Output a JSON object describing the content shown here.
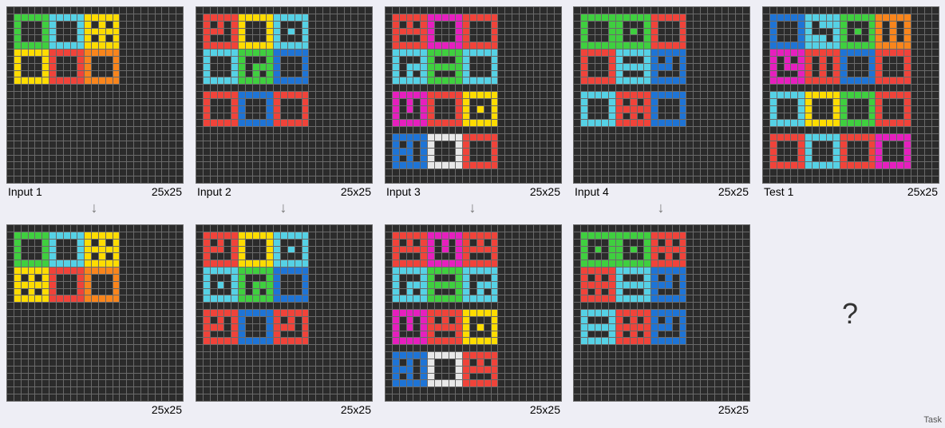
{
  "colors": {
    "0": "#2b2b2b",
    "1": "#1e74d6",
    "2": "#f0433a",
    "3": "#3fcf3f",
    "4": "#ffdc00",
    "5": "#999999",
    "6": "#e61fbe",
    "7": "#f9851c",
    "8": "#55d1e5",
    "9": "#6e1420",
    "W": "#e8e8e8"
  },
  "panels": [
    {
      "id": "input-1",
      "label": "Input 1",
      "size": "25x25",
      "shapes": [
        {
          "r": 1,
          "c": 1,
          "color": "3",
          "type": "box"
        },
        {
          "r": 1,
          "c": 6,
          "color": "8",
          "type": "box"
        },
        {
          "r": 1,
          "c": 11,
          "color": "4",
          "type": "dots"
        },
        {
          "r": 6,
          "c": 1,
          "color": "4",
          "type": "box"
        },
        {
          "r": 6,
          "c": 6,
          "color": "2",
          "type": "box"
        },
        {
          "r": 6,
          "c": 11,
          "color": "7",
          "type": "box"
        }
      ]
    },
    {
      "id": "input-2",
      "label": "Input 2",
      "size": "25x25",
      "shapes": [
        {
          "r": 1,
          "c": 1,
          "color": "2",
          "type": "smile"
        },
        {
          "r": 1,
          "c": 6,
          "color": "4",
          "type": "box"
        },
        {
          "r": 1,
          "c": 11,
          "color": "8",
          "type": "dot"
        },
        {
          "r": 6,
          "c": 1,
          "color": "8",
          "type": "box"
        },
        {
          "r": 6,
          "c": 6,
          "color": "3",
          "type": "hook"
        },
        {
          "r": 6,
          "c": 11,
          "color": "1",
          "type": "box"
        },
        {
          "r": 12,
          "c": 1,
          "color": "2",
          "type": "box"
        },
        {
          "r": 12,
          "c": 6,
          "color": "1",
          "type": "box"
        },
        {
          "r": 12,
          "c": 11,
          "color": "2",
          "type": "box"
        }
      ]
    },
    {
      "id": "input-3",
      "label": "Input 3",
      "size": "25x25",
      "shapes": [
        {
          "r": 1,
          "c": 1,
          "color": "2",
          "type": "face"
        },
        {
          "r": 1,
          "c": 6,
          "color": "6",
          "type": "box"
        },
        {
          "r": 1,
          "c": 11,
          "color": "2",
          "type": "box"
        },
        {
          "r": 6,
          "c": 1,
          "color": "8",
          "type": "hook"
        },
        {
          "r": 6,
          "c": 6,
          "color": "3",
          "type": "bar"
        },
        {
          "r": 6,
          "c": 11,
          "color": "8",
          "type": "box"
        },
        {
          "r": 12,
          "c": 1,
          "color": "6",
          "type": "cup"
        },
        {
          "r": 12,
          "c": 6,
          "color": "2",
          "type": "box"
        },
        {
          "r": 12,
          "c": 11,
          "color": "4",
          "type": "dot"
        },
        {
          "r": 18,
          "c": 1,
          "color": "1",
          "type": "vcup"
        },
        {
          "r": 18,
          "c": 6,
          "color": "W",
          "type": "box"
        },
        {
          "r": 18,
          "c": 11,
          "color": "2",
          "type": "box"
        }
      ]
    },
    {
      "id": "input-4",
      "label": "Input 4",
      "size": "25x25",
      "shapes": [
        {
          "r": 1,
          "c": 1,
          "color": "3",
          "type": "box"
        },
        {
          "r": 1,
          "c": 6,
          "color": "3",
          "type": "dot"
        },
        {
          "r": 1,
          "c": 11,
          "color": "2",
          "type": "box"
        },
        {
          "r": 6,
          "c": 1,
          "color": "2",
          "type": "box"
        },
        {
          "r": 6,
          "c": 6,
          "color": "8",
          "type": "bar"
        },
        {
          "r": 6,
          "c": 11,
          "color": "1",
          "type": "smile"
        },
        {
          "r": 12,
          "c": 1,
          "color": "8",
          "type": "box"
        },
        {
          "r": 12,
          "c": 6,
          "color": "2",
          "type": "dots"
        },
        {
          "r": 12,
          "c": 11,
          "color": "1",
          "type": "box"
        }
      ]
    },
    {
      "id": "test-1",
      "label": "Test 1",
      "size": "25x25",
      "shapes": [
        {
          "r": 1,
          "c": 1,
          "color": "1",
          "type": "box"
        },
        {
          "r": 1,
          "c": 6,
          "color": "8",
          "type": "hook2"
        },
        {
          "r": 1,
          "c": 11,
          "color": "3",
          "type": "dot"
        },
        {
          "r": 1,
          "c": 16,
          "color": "7",
          "type": "bars"
        },
        {
          "r": 6,
          "c": 1,
          "color": "6",
          "type": "hook3"
        },
        {
          "r": 6,
          "c": 6,
          "color": "2",
          "type": "bars"
        },
        {
          "r": 6,
          "c": 11,
          "color": "1",
          "type": "box"
        },
        {
          "r": 6,
          "c": 16,
          "color": "2",
          "type": "box"
        },
        {
          "r": 12,
          "c": 1,
          "color": "8",
          "type": "box"
        },
        {
          "r": 12,
          "c": 6,
          "color": "4",
          "type": "box"
        },
        {
          "r": 12,
          "c": 11,
          "color": "3",
          "type": "box"
        },
        {
          "r": 12,
          "c": 16,
          "color": "2",
          "type": "box"
        },
        {
          "r": 18,
          "c": 1,
          "color": "2",
          "type": "box"
        },
        {
          "r": 18,
          "c": 6,
          "color": "8",
          "type": "box"
        },
        {
          "r": 18,
          "c": 11,
          "color": "2",
          "type": "box"
        },
        {
          "r": 18,
          "c": 16,
          "color": "6",
          "type": "box"
        }
      ]
    },
    {
      "id": "output-1",
      "label": "",
      "size": "25x25",
      "shapes": [
        {
          "r": 1,
          "c": 1,
          "color": "3",
          "type": "box"
        },
        {
          "r": 1,
          "c": 6,
          "color": "8",
          "type": "box"
        },
        {
          "r": 1,
          "c": 11,
          "color": "4",
          "type": "dots"
        },
        {
          "r": 6,
          "c": 1,
          "color": "4",
          "type": "dots"
        },
        {
          "r": 6,
          "c": 6,
          "color": "2",
          "type": "box"
        },
        {
          "r": 6,
          "c": 11,
          "color": "7",
          "type": "box"
        }
      ]
    },
    {
      "id": "output-2",
      "label": "",
      "size": "25x25",
      "shapes": [
        {
          "r": 1,
          "c": 1,
          "color": "2",
          "type": "smile"
        },
        {
          "r": 1,
          "c": 6,
          "color": "4",
          "type": "box"
        },
        {
          "r": 1,
          "c": 11,
          "color": "8",
          "type": "dot"
        },
        {
          "r": 6,
          "c": 1,
          "color": "8",
          "type": "dot"
        },
        {
          "r": 6,
          "c": 6,
          "color": "3",
          "type": "hook"
        },
        {
          "r": 6,
          "c": 11,
          "color": "1",
          "type": "box"
        },
        {
          "r": 12,
          "c": 1,
          "color": "2",
          "type": "smile"
        },
        {
          "r": 12,
          "c": 6,
          "color": "1",
          "type": "box"
        },
        {
          "r": 12,
          "c": 11,
          "color": "2",
          "type": "smile"
        }
      ]
    },
    {
      "id": "output-3",
      "label": "",
      "size": "25x25",
      "shapes": [
        {
          "r": 1,
          "c": 1,
          "color": "2",
          "type": "face"
        },
        {
          "r": 1,
          "c": 6,
          "color": "6",
          "type": "cup"
        },
        {
          "r": 1,
          "c": 11,
          "color": "2",
          "type": "face"
        },
        {
          "r": 6,
          "c": 1,
          "color": "8",
          "type": "hook"
        },
        {
          "r": 6,
          "c": 6,
          "color": "3",
          "type": "bar"
        },
        {
          "r": 6,
          "c": 11,
          "color": "8",
          "type": "hook"
        },
        {
          "r": 12,
          "c": 1,
          "color": "6",
          "type": "cup"
        },
        {
          "r": 12,
          "c": 6,
          "color": "2",
          "type": "face"
        },
        {
          "r": 12,
          "c": 11,
          "color": "4",
          "type": "dot"
        },
        {
          "r": 18,
          "c": 1,
          "color": "1",
          "type": "vcup"
        },
        {
          "r": 18,
          "c": 6,
          "color": "W",
          "type": "box"
        },
        {
          "r": 18,
          "c": 11,
          "color": "2",
          "type": "face"
        }
      ]
    },
    {
      "id": "output-4",
      "label": "",
      "size": "25x25",
      "shapes": [
        {
          "r": 1,
          "c": 1,
          "color": "3",
          "type": "dot"
        },
        {
          "r": 1,
          "c": 6,
          "color": "3",
          "type": "dot"
        },
        {
          "r": 1,
          "c": 11,
          "color": "2",
          "type": "dots"
        },
        {
          "r": 6,
          "c": 1,
          "color": "2",
          "type": "dots"
        },
        {
          "r": 6,
          "c": 6,
          "color": "8",
          "type": "bar"
        },
        {
          "r": 6,
          "c": 11,
          "color": "1",
          "type": "smile"
        },
        {
          "r": 12,
          "c": 1,
          "color": "8",
          "type": "bar"
        },
        {
          "r": 12,
          "c": 6,
          "color": "2",
          "type": "dots"
        },
        {
          "r": 12,
          "c": 11,
          "color": "1",
          "type": "smile"
        }
      ]
    }
  ],
  "question_mark": "?",
  "task_label": "Task"
}
